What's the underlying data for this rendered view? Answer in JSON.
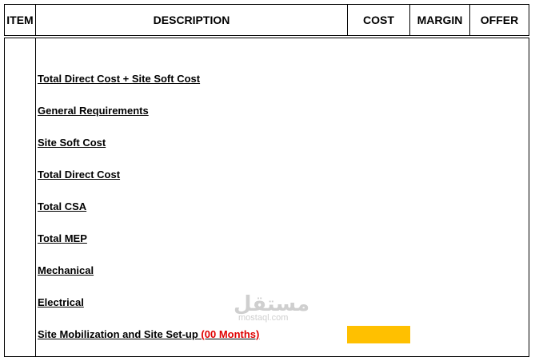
{
  "table": {
    "headers": {
      "item": "ITEM",
      "description": "DESCRIPTION",
      "cost": "COST",
      "margin": "MARGIN",
      "offer": "OFFER"
    },
    "rows": [
      {
        "description": "Total Direct Cost + Site Soft Cost"
      },
      {
        "description": "General Requirements"
      },
      {
        "description": "Site Soft Cost"
      },
      {
        "description": "Total Direct Cost"
      },
      {
        "description": "Total CSA"
      },
      {
        "description": "Total MEP"
      },
      {
        "description": "Mechanical"
      },
      {
        "description": "Electrical"
      },
      {
        "description": "Site Mobilization and Site Set-up",
        "suffix": "(00 Months)",
        "cost_highlight": "#ffc000"
      }
    ]
  },
  "watermark": {
    "arabic": "مستقل",
    "url": "mostaql.com"
  }
}
